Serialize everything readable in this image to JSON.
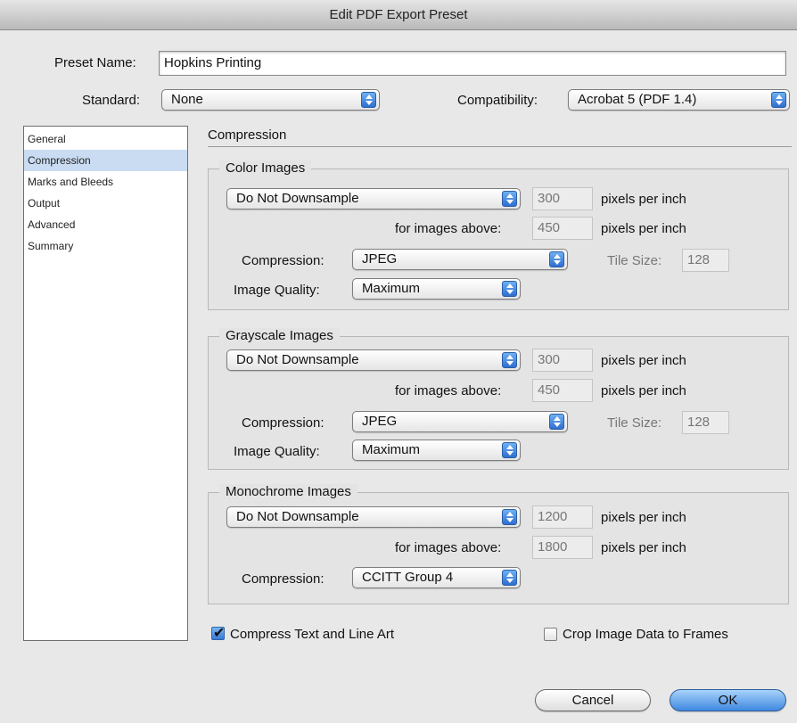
{
  "window": {
    "title": "Edit PDF Export Preset"
  },
  "preset": {
    "label": "Preset Name:",
    "value": "Hopkins Printing"
  },
  "standard": {
    "label": "Standard:",
    "value": "None"
  },
  "compatibility": {
    "label": "Compatibility:",
    "value": "Acrobat 5 (PDF 1.4)"
  },
  "sidebar": {
    "items": [
      {
        "label": "General"
      },
      {
        "label": "Compression"
      },
      {
        "label": "Marks and Bleeds"
      },
      {
        "label": "Output"
      },
      {
        "label": "Advanced"
      },
      {
        "label": "Summary"
      }
    ],
    "selected": "Compression"
  },
  "section": {
    "title": "Compression"
  },
  "common": {
    "ppi_label": "pixels per inch",
    "above_label": "for images above:",
    "compression_label": "Compression:",
    "quality_label": "Image Quality:",
    "tile_label": "Tile Size:"
  },
  "color": {
    "title": "Color Images",
    "downsample": "Do Not Downsample",
    "ppi": "300",
    "above": "450",
    "compression": "JPEG",
    "tile": "128",
    "quality": "Maximum"
  },
  "gray": {
    "title": "Grayscale Images",
    "downsample": "Do Not Downsample",
    "ppi": "300",
    "above": "450",
    "compression": "JPEG",
    "tile": "128",
    "quality": "Maximum"
  },
  "mono": {
    "title": "Monochrome Images",
    "downsample": "Do Not Downsample",
    "ppi": "1200",
    "above": "1800",
    "compression": "CCITT Group 4"
  },
  "options": {
    "compress_text": {
      "label": "Compress Text and Line Art",
      "checked": true
    },
    "crop_image": {
      "label": "Crop Image Data to Frames",
      "checked": false
    }
  },
  "buttons": {
    "cancel": "Cancel",
    "ok": "OK"
  },
  "colors": {
    "accent": "#3f88e0",
    "selection": "#c9dcf2"
  }
}
